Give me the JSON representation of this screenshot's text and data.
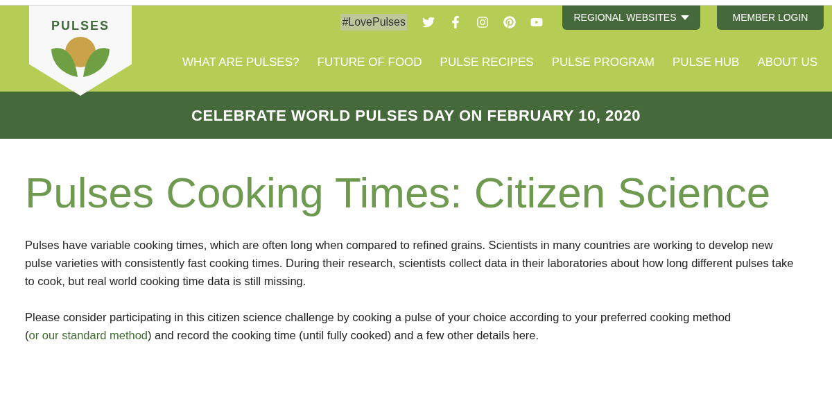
{
  "logo": {
    "text": "PULSES"
  },
  "hashtag": "#LovePulses",
  "social": [
    {
      "kind": "twitter"
    },
    {
      "kind": "facebook"
    },
    {
      "kind": "instagram"
    },
    {
      "kind": "pinterest"
    },
    {
      "kind": "youtube"
    }
  ],
  "top_buttons": [
    {
      "label": "REGIONAL WEBSITES",
      "dropdown": true
    },
    {
      "label": "MEMBER LOGIN",
      "dropdown": false
    }
  ],
  "nav": [
    "WHAT ARE PULSES?",
    "FUTURE OF FOOD",
    "PULSE RECIPES",
    "PULSE PROGRAM",
    "PULSE HUB",
    "ABOUT US"
  ],
  "banner": "CELEBRATE WORLD PULSES DAY ON FEBRUARY 10, 2020",
  "title": "Pulses Cooking Times: Citizen Science",
  "paragraph_1": "Pulses have variable cooking times, which are often long when compared to refined grains. Scientists in many countries are working to develop new pulse varieties with consistently fast cooking times. During their research, scientists collect data in their laboratories about how long different pulses take to cook, but real world cooking time data is still missing.",
  "paragraph_2": {
    "before": "Please consider participating in this citizen science challenge by cooking a pulse of your choice according to your preferred cooking method (",
    "link": "or our standard method",
    "after": ") and record the cooking time (until fully cooked) and a few other details here."
  }
}
